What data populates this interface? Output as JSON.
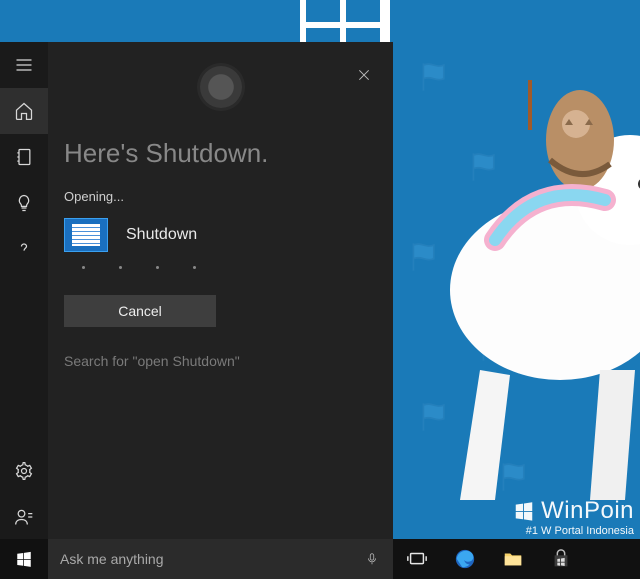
{
  "cortana": {
    "heading": "Here's Shutdown.",
    "opening_label": "Opening...",
    "result_label": "Shutdown",
    "cancel_label": "Cancel",
    "suggest_text": "Search for \"open Shutdown\""
  },
  "rail": {
    "items": [
      {
        "name": "menu-icon"
      },
      {
        "name": "home-icon",
        "active": true
      },
      {
        "name": "notebook-icon"
      },
      {
        "name": "lightbulb-icon"
      },
      {
        "name": "help-icon"
      }
    ],
    "bottom": [
      {
        "name": "settings-icon"
      },
      {
        "name": "feedback-icon"
      }
    ]
  },
  "taskbar": {
    "search_placeholder": "Ask me anything",
    "items": [
      {
        "name": "task-view-icon"
      },
      {
        "name": "edge-browser-icon"
      },
      {
        "name": "file-explorer-icon"
      },
      {
        "name": "store-icon"
      }
    ]
  },
  "watermark": {
    "brand_prefix": "WinP",
    "brand_suffix": "oin",
    "tagline_prefix": "#1 W",
    "tagline_suffix": " Portal Indonesia"
  }
}
